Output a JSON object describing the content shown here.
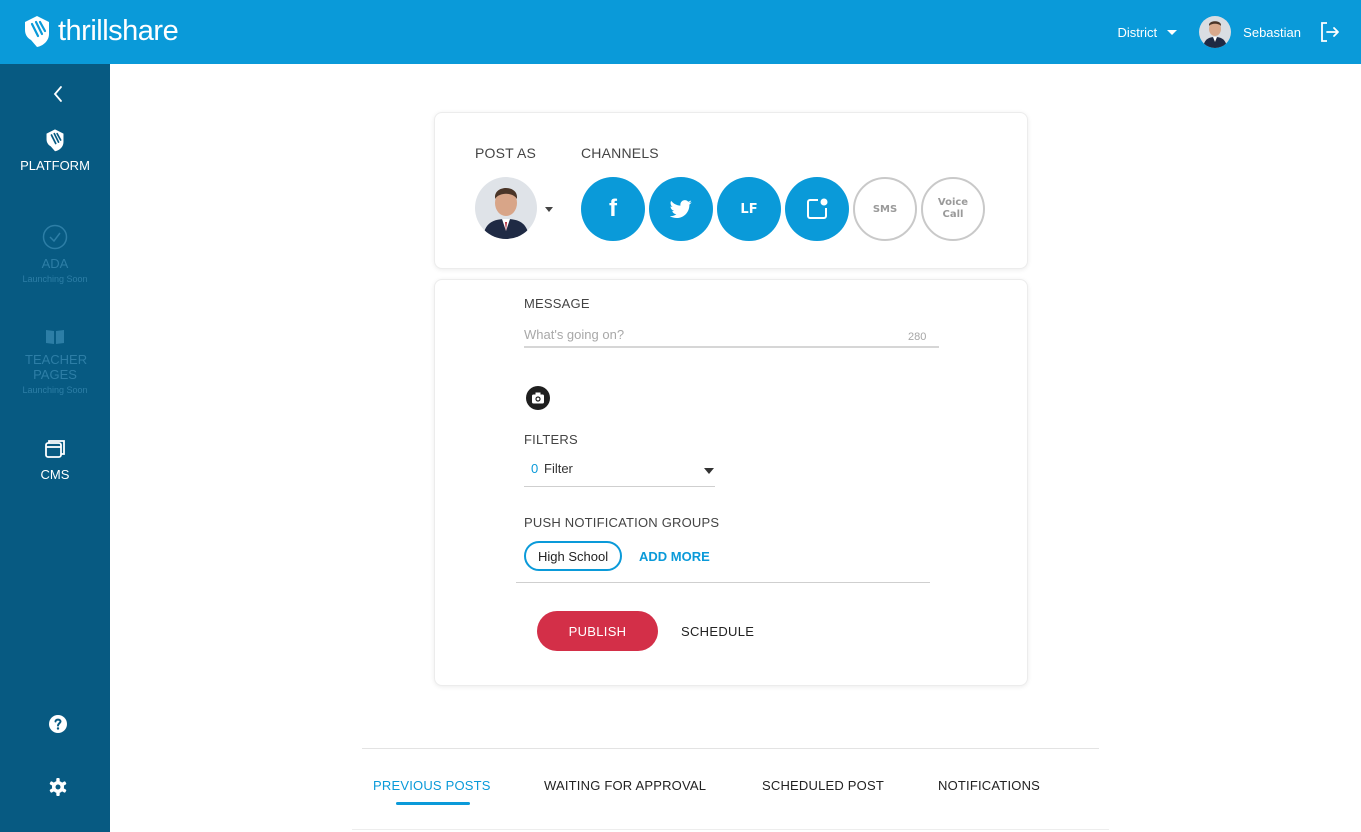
{
  "app": {
    "name": "thrillshare",
    "brand_color": "#0a9ad9",
    "sidebar_color": "#075a82",
    "publish_color": "#d32f48"
  },
  "header": {
    "district_label": "District",
    "user_name": "Sebastian"
  },
  "sidebar": {
    "items": [
      {
        "label": "PLATFORM",
        "sub": ""
      },
      {
        "label": "ADA",
        "sub": "Launching Soon"
      },
      {
        "label": "TEACHER PAGES",
        "sub": "Launching Soon"
      },
      {
        "label": "CMS",
        "sub": ""
      }
    ]
  },
  "post": {
    "post_as_label": "POST AS",
    "channels_label": "CHANNELS",
    "channels": [
      {
        "name": "facebook",
        "text": "f",
        "active": true
      },
      {
        "name": "twitter",
        "text": "",
        "active": true
      },
      {
        "name": "live-feed",
        "text": "LF",
        "active": true
      },
      {
        "name": "push",
        "text": "",
        "active": true
      },
      {
        "name": "sms",
        "text": "SMS",
        "active": false
      },
      {
        "name": "voice-call",
        "text": "Voice Call",
        "active": false
      }
    ]
  },
  "message": {
    "label": "MESSAGE",
    "placeholder": "What's going on?",
    "counter": "280",
    "filters_label": "FILTERS",
    "filter_count": "0",
    "filter_text": "Filter",
    "groups_label": "PUSH NOTIFICATION GROUPS",
    "group_chip": "High School",
    "add_more": "ADD MORE",
    "publish": "PUBLISH",
    "schedule": "SCHEDULE"
  },
  "tabs": [
    {
      "label": "PREVIOUS POSTS",
      "active": true
    },
    {
      "label": "WAITING FOR APPROVAL",
      "active": false
    },
    {
      "label": "SCHEDULED POST",
      "active": false
    },
    {
      "label": "NOTIFICATIONS",
      "active": false
    }
  ]
}
